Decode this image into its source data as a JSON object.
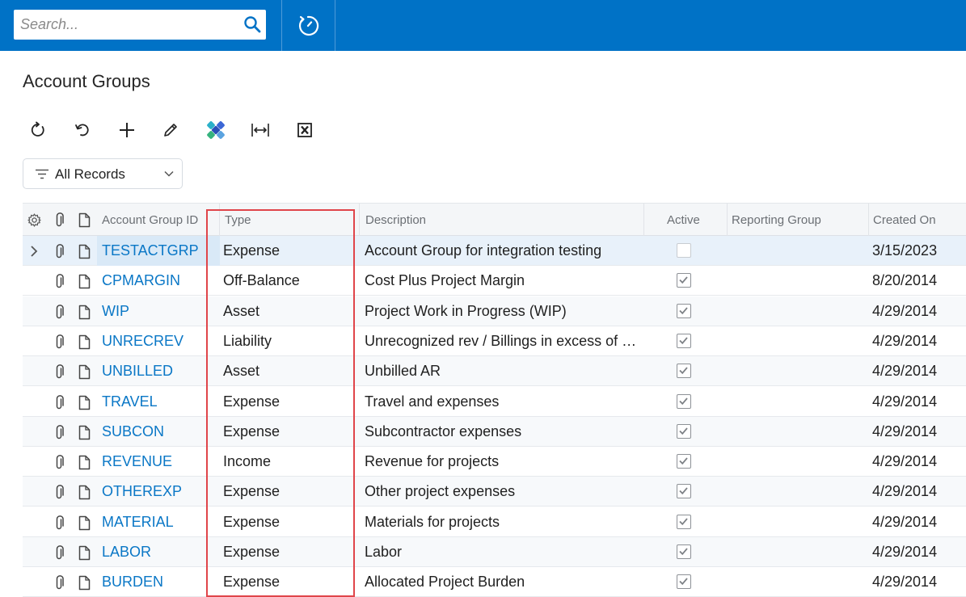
{
  "search": {
    "placeholder": "Search..."
  },
  "page": {
    "title": "Account Groups"
  },
  "toolbar": {
    "icons": [
      "refresh-icon",
      "undo-icon",
      "add-icon",
      "edit-icon",
      "puzzle-icon",
      "fit-columns-icon",
      "excel-export-icon"
    ]
  },
  "filter": {
    "label": "All Records"
  },
  "colors": {
    "topbar": "#0072c6",
    "link": "#0a77c6",
    "highlight": "#e0454a"
  },
  "grid": {
    "columns": {
      "id": "Account Group ID",
      "type": "Type",
      "description": "Description",
      "active": "Active",
      "reporting_group": "Reporting Group",
      "created_on": "Created On"
    },
    "rows": [
      {
        "id": "TESTACTGRP",
        "type": "Expense",
        "description": "Account Group for integration testing",
        "active": false,
        "reporting_group": "",
        "created_on": "3/15/2023"
      },
      {
        "id": "CPMARGIN",
        "type": "Off-Balance",
        "description": "Cost Plus Project Margin",
        "active": true,
        "reporting_group": "",
        "created_on": "8/20/2014"
      },
      {
        "id": "WIP",
        "type": "Asset",
        "description": "Project Work in Progress (WIP)",
        "active": true,
        "reporting_group": "",
        "created_on": "4/29/2014"
      },
      {
        "id": "UNRECREV",
        "type": "Liability",
        "description": "Unrecognized rev / Billings in excess of c…",
        "active": true,
        "reporting_group": "",
        "created_on": "4/29/2014"
      },
      {
        "id": "UNBILLED",
        "type": "Asset",
        "description": "Unbilled AR",
        "active": true,
        "reporting_group": "",
        "created_on": "4/29/2014"
      },
      {
        "id": "TRAVEL",
        "type": "Expense",
        "description": "Travel and expenses",
        "active": true,
        "reporting_group": "",
        "created_on": "4/29/2014"
      },
      {
        "id": "SUBCON",
        "type": "Expense",
        "description": "Subcontractor expenses",
        "active": true,
        "reporting_group": "",
        "created_on": "4/29/2014"
      },
      {
        "id": "REVENUE",
        "type": "Income",
        "description": "Revenue for projects",
        "active": true,
        "reporting_group": "",
        "created_on": "4/29/2014"
      },
      {
        "id": "OTHEREXP",
        "type": "Expense",
        "description": "Other project expenses",
        "active": true,
        "reporting_group": "",
        "created_on": "4/29/2014"
      },
      {
        "id": "MATERIAL",
        "type": "Expense",
        "description": "Materials for projects",
        "active": true,
        "reporting_group": "",
        "created_on": "4/29/2014"
      },
      {
        "id": "LABOR",
        "type": "Expense",
        "description": "Labor",
        "active": true,
        "reporting_group": "",
        "created_on": "4/29/2014"
      },
      {
        "id": "BURDEN",
        "type": "Expense",
        "description": "Allocated Project Burden",
        "active": true,
        "reporting_group": "",
        "created_on": "4/29/2014"
      }
    ]
  }
}
